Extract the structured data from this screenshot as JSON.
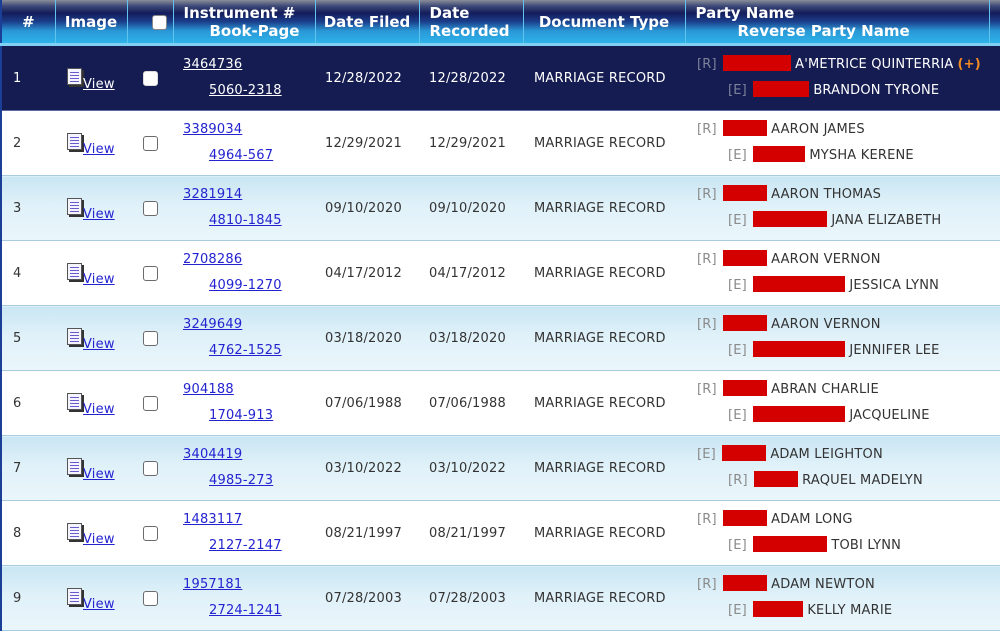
{
  "headers": {
    "num": "#",
    "image": "Image",
    "instrument_line1": "Instrument #",
    "instrument_line2": "Book-Page",
    "date_filed": "Date Filed",
    "date_recorded_line1": "Date",
    "date_recorded_line2": "Recorded",
    "document_type": "Document Type",
    "party_line1": "Party Name",
    "party_line2": "Reverse Party Name"
  },
  "view_label": "View",
  "more_parties_label": "(+)",
  "colors": {
    "selected_row": "#151c52",
    "redaction": "#d40000",
    "link": "#2323d0",
    "more_indicator": "#f08a24"
  },
  "rows": [
    {
      "num": "1",
      "instrument": "3464736",
      "book_page": "5060-2318",
      "date_filed": "12/28/2022",
      "date_recorded": "12/28/2022",
      "doc_type": "MARRIAGE RECORD",
      "party1_role": "[R]",
      "party1_name": "A'METRICE QUINTERRIA",
      "party2_role": "[E]",
      "party2_name": "BRANDON TYRONE",
      "selected": true,
      "has_more": true
    },
    {
      "num": "2",
      "instrument": "3389034",
      "book_page": "4964-567",
      "date_filed": "12/29/2021",
      "date_recorded": "12/29/2021",
      "doc_type": "MARRIAGE RECORD",
      "party1_role": "[R]",
      "party1_name": "AARON JAMES",
      "party2_role": "[E]",
      "party2_name": "MYSHA KERENE"
    },
    {
      "num": "3",
      "instrument": "3281914",
      "book_page": "4810-1845",
      "date_filed": "09/10/2020",
      "date_recorded": "09/10/2020",
      "doc_type": "MARRIAGE RECORD",
      "party1_role": "[R]",
      "party1_name": "AARON THOMAS",
      "party2_role": "[E]",
      "party2_name": "JANA ELIZABETH"
    },
    {
      "num": "4",
      "instrument": "2708286",
      "book_page": "4099-1270",
      "date_filed": "04/17/2012",
      "date_recorded": "04/17/2012",
      "doc_type": "MARRIAGE RECORD",
      "party1_role": "[R]",
      "party1_name": "AARON VERNON",
      "party2_role": "[E]",
      "party2_name": "JESSICA LYNN"
    },
    {
      "num": "5",
      "instrument": "3249649",
      "book_page": "4762-1525",
      "date_filed": "03/18/2020",
      "date_recorded": "03/18/2020",
      "doc_type": "MARRIAGE RECORD",
      "party1_role": "[R]",
      "party1_name": "AARON VERNON",
      "party2_role": "[E]",
      "party2_name": "JENNIFER LEE"
    },
    {
      "num": "6",
      "instrument": "904188",
      "book_page": "1704-913",
      "date_filed": "07/06/1988",
      "date_recorded": "07/06/1988",
      "doc_type": "MARRIAGE RECORD",
      "party1_role": "[R]",
      "party1_name": "ABRAN CHARLIE",
      "party2_role": "[E]",
      "party2_name": "JACQUELINE"
    },
    {
      "num": "7",
      "instrument": "3404419",
      "book_page": "4985-273",
      "date_filed": "03/10/2022",
      "date_recorded": "03/10/2022",
      "doc_type": "MARRIAGE RECORD",
      "party1_role": "[E]",
      "party1_name": "ADAM LEIGHTON",
      "party2_role": "[R]",
      "party2_name": "RAQUEL MADELYN"
    },
    {
      "num": "8",
      "instrument": "1483117",
      "book_page": "2127-2147",
      "date_filed": "08/21/1997",
      "date_recorded": "08/21/1997",
      "doc_type": "MARRIAGE RECORD",
      "party1_role": "[R]",
      "party1_name": "ADAM LONG",
      "party2_role": "[E]",
      "party2_name": "TOBI LYNN"
    },
    {
      "num": "9",
      "instrument": "1957181",
      "book_page": "2724-1241",
      "date_filed": "07/28/2003",
      "date_recorded": "07/28/2003",
      "doc_type": "MARRIAGE RECORD",
      "party1_role": "[R]",
      "party1_name": "ADAM NEWTON",
      "party2_role": "[E]",
      "party2_name": "KELLY MARIE"
    }
  ]
}
